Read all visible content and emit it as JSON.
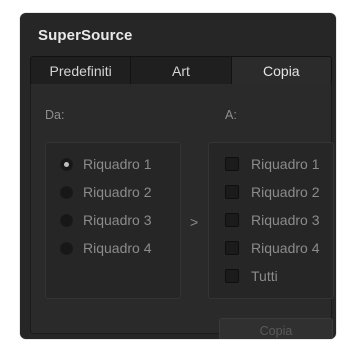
{
  "panel": {
    "title": "SuperSource"
  },
  "tabs": [
    {
      "label": "Predefiniti",
      "active": false
    },
    {
      "label": "Art",
      "active": false
    },
    {
      "label": "Copia",
      "active": true
    }
  ],
  "copy": {
    "from_label": "Da:",
    "to_label": "A:",
    "from_options": [
      {
        "label": "Riquadro 1",
        "selected": true
      },
      {
        "label": "Riquadro 2",
        "selected": false
      },
      {
        "label": "Riquadro 3",
        "selected": false
      },
      {
        "label": "Riquadro 4",
        "selected": false
      }
    ],
    "to_options": [
      {
        "label": "Riquadro 1",
        "checked": false
      },
      {
        "label": "Riquadro 2",
        "checked": false
      },
      {
        "label": "Riquadro 3",
        "checked": false
      },
      {
        "label": "Riquadro 4",
        "checked": false
      },
      {
        "label": "Tutti",
        "checked": false
      }
    ],
    "arrow_icon": "chevron-right-icon",
    "chevron_glyph": ">",
    "button_label": "Copia",
    "button_enabled": false
  },
  "colors": {
    "panel_bg": "#262626",
    "text_primary": "#e8e8e8",
    "text_dim": "#8b8b8b"
  }
}
